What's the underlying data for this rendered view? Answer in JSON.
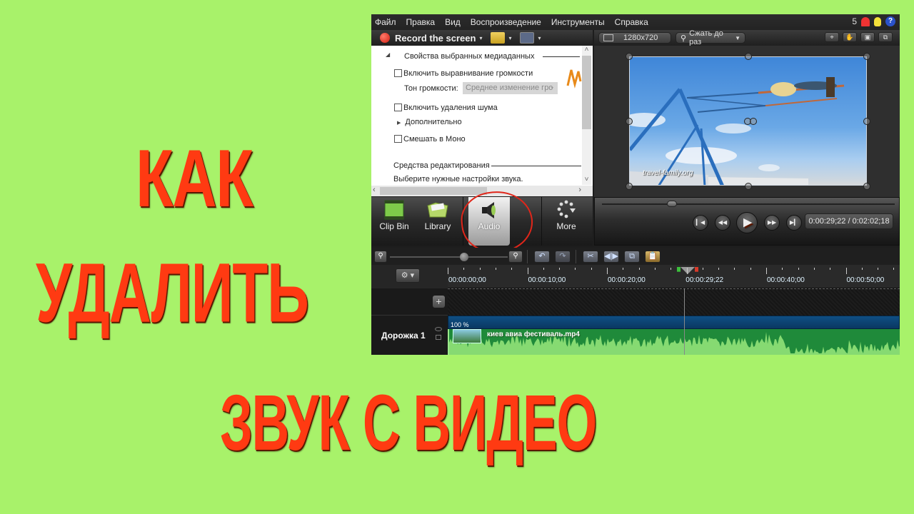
{
  "overlay": {
    "title_line1": "КАК",
    "title_line2": "УДАЛИТЬ",
    "title_line3": "ЗВУК С ВИДЕО",
    "title_color": "#ff3a12",
    "background_color": "#a8f26a"
  },
  "menu": {
    "items": [
      "Файл",
      "Правка",
      "Вид",
      "Воспроизведение",
      "Инструменты",
      "Справка"
    ],
    "notification_count": "5",
    "help_glyph": "?"
  },
  "toolbar": {
    "record_label": "Record the screen",
    "dropdown_glyph": "▾"
  },
  "preview_toolbar": {
    "resolution": "1280x720",
    "zoom_label": "Сжать до раз",
    "tools": [
      "crop-icon",
      "pan-icon",
      "fit-icon",
      "detach-icon"
    ]
  },
  "properties": {
    "section_title": "Свойства выбранных медиаданных",
    "volume_leveling_label": "Включить выравнивание громкости",
    "volume_leveling_checked": false,
    "volume_tone_label": "Тон громкости:",
    "volume_tone_value": "Среднее изменение гро",
    "noise_removal_label": "Включить удаления шума",
    "noise_removal_checked": false,
    "advanced_label": "Дополнительно",
    "mix_mono_label": "Смешать в Моно",
    "mix_mono_checked": false,
    "editing_tools_title": "Средства редактирования",
    "editing_tools_hint": "Выберите нужные настройки звука."
  },
  "tabs": [
    {
      "label": "Clip Bin",
      "icon": "film-icon",
      "active": false
    },
    {
      "label": "Library",
      "icon": "library-folder-icon",
      "active": false
    },
    {
      "label": "Audio",
      "icon": "speaker-icon",
      "active": true
    },
    {
      "label": "More",
      "icon": "more-dots-icon",
      "active": false
    }
  ],
  "preview": {
    "watermark": "travel-family.org"
  },
  "player": {
    "timecode": "0:00:29;22 / 0:02:02;18",
    "position_fraction": 0.24
  },
  "timeline": {
    "ruler_labels": [
      "00:00:00;00",
      "00:00:10;00",
      "00:00:20;00",
      "00:00:29;22",
      "00:00:40;00",
      "00:00:50;00"
    ],
    "playhead_time": "00:00:29;22",
    "zoom_fraction": 0.63,
    "tracks": [
      {
        "name": "Дорожка 1",
        "clip_name": "киев авиа фестиваль.mp4",
        "volume_label": "100 %"
      }
    ]
  }
}
